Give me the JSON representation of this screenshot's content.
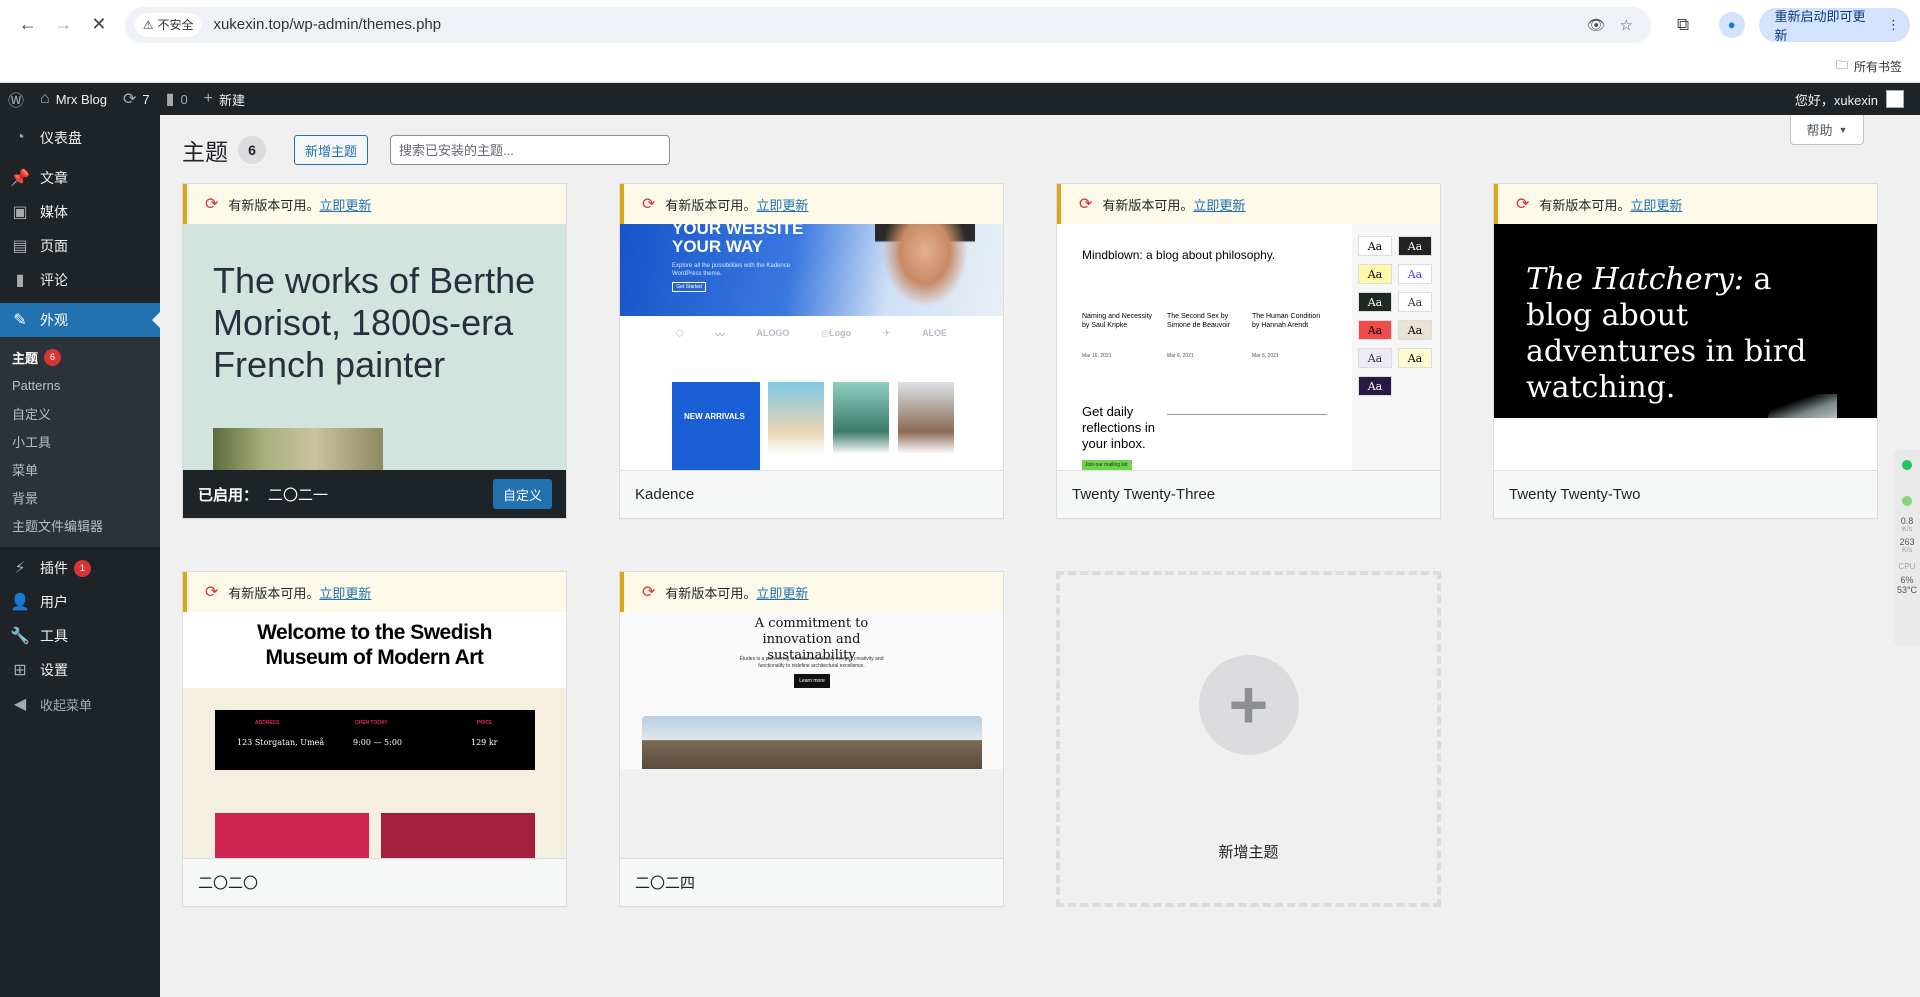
{
  "browser": {
    "insecure_label": "不安全",
    "url": "xukexin.top/wp-admin/themes.php",
    "relaunch_label": "重新启动即可更新",
    "bookmarks_label": "所有书签"
  },
  "adminbar": {
    "site_name": "Mrx Blog",
    "updates_count": "7",
    "comments_count": "0",
    "new_label": "新建",
    "greeting": "您好，xukexin"
  },
  "sidebar": {
    "items": [
      {
        "label": "仪表盘",
        "icon": "dashboard-icon"
      },
      {
        "label": "文章",
        "icon": "pin-icon"
      },
      {
        "label": "媒体",
        "icon": "media-icon"
      },
      {
        "label": "页面",
        "icon": "page-icon"
      },
      {
        "label": "评论",
        "icon": "comment-icon"
      },
      {
        "label": "外观",
        "icon": "brush-icon"
      },
      {
        "label": "插件",
        "icon": "plugin-icon",
        "badge": "1"
      },
      {
        "label": "用户",
        "icon": "user-icon"
      },
      {
        "label": "工具",
        "icon": "wrench-icon"
      },
      {
        "label": "设置",
        "icon": "settings-icon"
      }
    ],
    "submenu": [
      {
        "label": "主题",
        "badge": "6"
      },
      {
        "label": "Patterns"
      },
      {
        "label": "自定义"
      },
      {
        "label": "小工具"
      },
      {
        "label": "菜单"
      },
      {
        "label": "背景"
      },
      {
        "label": "主题文件编辑器"
      }
    ],
    "collapse_label": "收起菜单"
  },
  "header": {
    "title": "主题",
    "count": "6",
    "add_new": "新增主题",
    "search_placeholder": "搜索已安装的主题...",
    "help": "帮助"
  },
  "update_notice": {
    "text": "有新版本可用。",
    "link": "立即更新"
  },
  "themes": [
    {
      "name": "二〇二一",
      "active_label": "已启用：",
      "customize_label": "自定义",
      "preview_text": "The works of Berthe Morisot, 1800s-era French painter"
    },
    {
      "name": "Kadence",
      "preview_hero": "YOUR WEBSITE YOUR WAY",
      "preview_sub": "Explore all the possibilities with the Kadence WordPress theme.",
      "preview_btn": "Get Started",
      "preview_logos": [
        "⬡",
        "〰",
        "ALOGO",
        "◎Logo",
        "✈",
        "ALOE"
      ],
      "preview_tile": "NEW ARRIVALS"
    },
    {
      "name": "Twenty Twenty-Three",
      "preview_heading": "Mindblown: a blog about philosophy.",
      "preview_posts": [
        {
          "title": "Naming and Necessity by Saul Kripke",
          "date": "Mar 16, 2021"
        },
        {
          "title": "The Second Sex by Simone de Beauvoir",
          "date": "Mar 6, 2021"
        },
        {
          "title": "The Human Condition by Hannah Arendt",
          "date": "Mar 6, 2021"
        }
      ],
      "preview_reflections": "Get daily reflections in your inbox.",
      "preview_join": "Join our mailing list",
      "preview_swatch": "Aa"
    },
    {
      "name": "Twenty Twenty-Two",
      "preview_italic": "The Hatchery:",
      "preview_rest": "a blog about adventures in bird watching."
    },
    {
      "name": "二〇二〇",
      "preview_heading": "Welcome to the Swedish Museum of Modern Art",
      "preview_info": [
        {
          "label": "ADDRESS",
          "value": "123 Storgatan, Umeå"
        },
        {
          "label": "OPEN TODAY",
          "value": "9:00 — 5:00"
        },
        {
          "label": "PRICE",
          "value": "129 kr"
        }
      ]
    },
    {
      "name": "二〇二四",
      "preview_heading": "A commitment to innovation and sustainability",
      "preview_sub": "Études is a pioneering firm that seamlessly merges creativity and functionality to redefine architectural excellence.",
      "preview_btn": "Learn more"
    }
  ],
  "add_new_theme_label": "新增主题",
  "side_widget": {
    "net1": "0.8",
    "unit1": "K/s",
    "net2": "263",
    "unit2": "K/s",
    "cpu_label": "CPU",
    "cpu": "6%",
    "temp": "53°C"
  },
  "colors": {
    "admin_bg": "#1d2327",
    "accent": "#2271b1",
    "badge": "#d63638",
    "notice_border": "#dba617"
  }
}
